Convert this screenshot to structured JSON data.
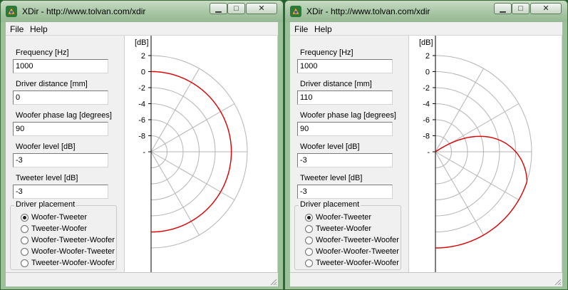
{
  "app": {
    "title": "XDir - http://www.tolvan.com/xdir",
    "icon": "xdir-app-icon",
    "window_controls": {
      "minimize": "▁",
      "maximize": "□",
      "close": "✕"
    },
    "menu": [
      "File",
      "Help"
    ]
  },
  "labels": {
    "frequency": "Frequency [Hz]",
    "distance": "Driver distance [mm]",
    "phase": "Woofer phase lag [degrees]",
    "woofer_level": "Woofer level [dB]",
    "tweeter_level": "Tweeter level [dB]",
    "placement": "Driver placement"
  },
  "placement_options": [
    "Woofer-Tweeter",
    "Tweeter-Woofer",
    "Woofer-Tweeter-Woofer",
    "Woofer-Woofer-Tweeter",
    "Tweeter-Woofer-Woofer"
  ],
  "plot": {
    "unit_label": "[dB]",
    "tick_labels": [
      "2",
      "0",
      "-2",
      "-4",
      "-6",
      "-8",
      "-"
    ],
    "curve_color": "#dd0000",
    "grid_color": "#b4b4b4"
  },
  "windows": [
    {
      "frequency": "1000",
      "distance": "0",
      "phase": "90",
      "woofer_level": "-3",
      "tweeter_level": "-3",
      "selected_placement": 0
    },
    {
      "frequency": "1000",
      "distance": "110",
      "phase": "90",
      "woofer_level": "-3",
      "tweeter_level": "-3",
      "selected_placement": 0
    }
  ]
}
